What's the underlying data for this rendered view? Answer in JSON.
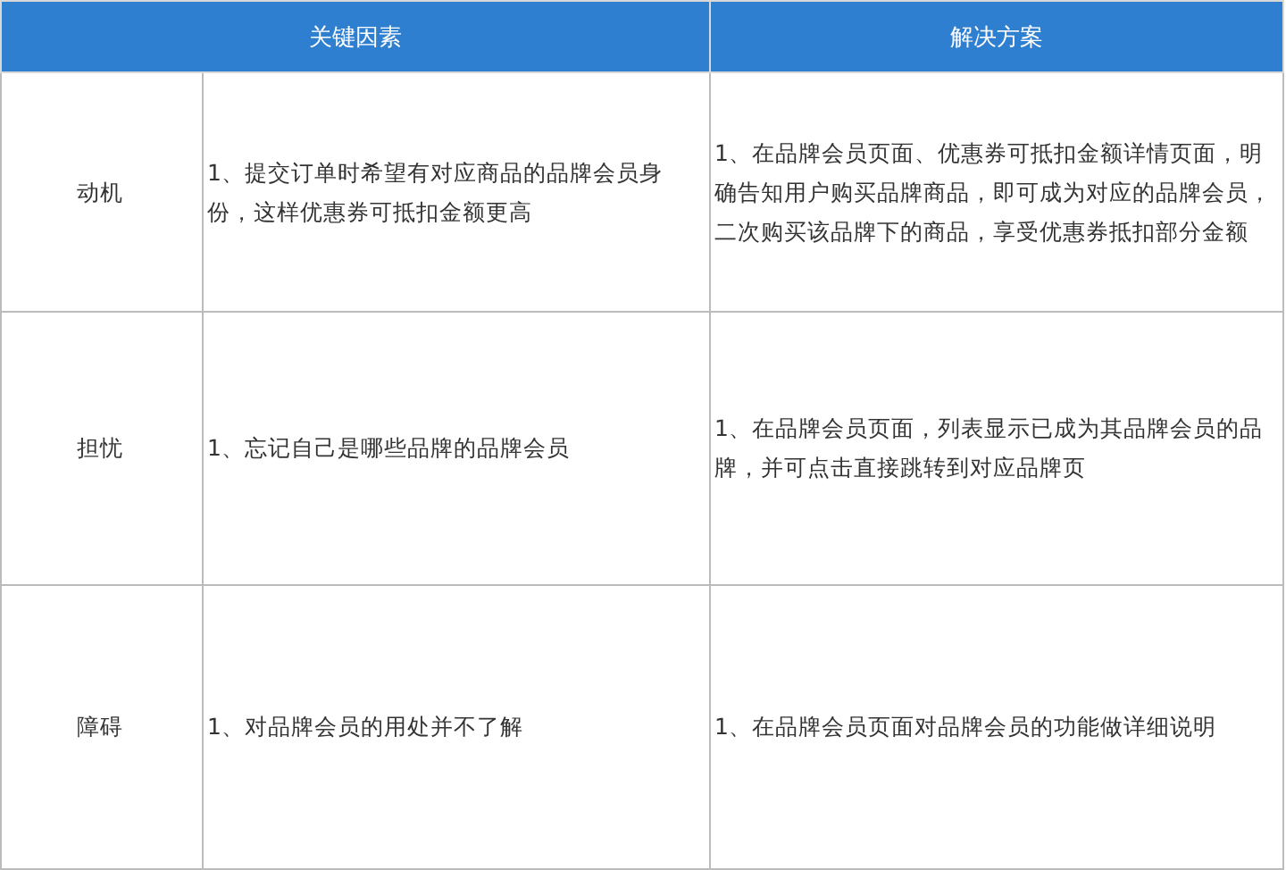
{
  "table": {
    "headers": [
      "关键因素",
      "解决方案"
    ],
    "rows": [
      {
        "factor": "动机",
        "situation": "1、提交订单时希望有对应商品的品牌会员身份，这样优惠券可抵扣金额更高",
        "solution": "1、在品牌会员页面、优惠券可抵扣金额详情页面，明确告知用户购买品牌商品，即可成为对应的品牌会员，二次购买该品牌下的商品，享受优惠券抵扣部分金额"
      },
      {
        "factor": "担忧",
        "situation": "1、忘记自己是哪些品牌的品牌会员",
        "solution": "1、在品牌会员页面，列表显示已成为其品牌会员的品牌，并可点击直接跳转到对应品牌页"
      },
      {
        "factor": "障碍",
        "situation": "1、对品牌会员的用处并不了解",
        "solution": "1、在品牌会员页面对品牌会员的功能做详细说明"
      }
    ]
  }
}
